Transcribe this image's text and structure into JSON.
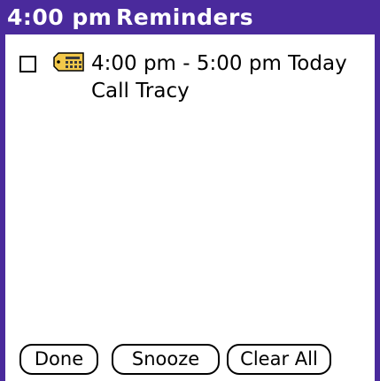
{
  "window": {
    "time": "4:00 pm",
    "title": "Reminders",
    "accent_color": "#4a2a9c"
  },
  "reminders": [
    {
      "checked": false,
      "icon": "calendar-icon",
      "time_range": "4:00 pm - 5:00 pm Today",
      "description": "Call Tracy"
    }
  ],
  "buttons": {
    "done": "Done",
    "snooze": "Snooze",
    "clear_all": "Clear All"
  }
}
